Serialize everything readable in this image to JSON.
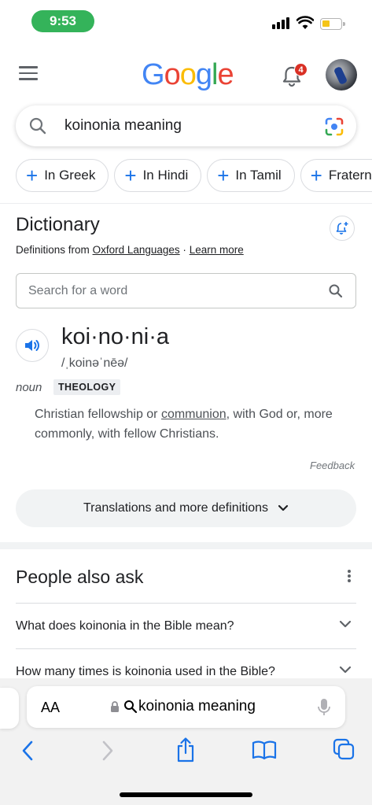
{
  "status_bar": {
    "time": "9:53"
  },
  "header": {
    "notification_count": "4"
  },
  "search": {
    "query": "koinonia meaning"
  },
  "chips": [
    {
      "label": "In Greek"
    },
    {
      "label": "In Hindi"
    },
    {
      "label": "In Tamil"
    },
    {
      "label": "Fraternity"
    }
  ],
  "dictionary": {
    "title": "Dictionary",
    "source_prefix": "Definitions from",
    "source_name": "Oxford Languages",
    "source_sep": "·",
    "learn_more": "Learn more",
    "search_placeholder": "Search for a word",
    "headword": "koi·no·ni·a",
    "phonetic": "/ˌkoinəˈnēə/",
    "part_of_speech": "noun",
    "subject": "THEOLOGY",
    "definition_before": "Christian fellowship or ",
    "definition_link": "communion",
    "definition_after": ", with God or, more commonly, with fellow Christians.",
    "feedback": "Feedback",
    "more_button": "Translations and more definitions"
  },
  "people_also_ask": {
    "title": "People also ask",
    "questions": [
      "What does koinonia in the Bible mean?",
      "How many times is koinonia used in the Bible?"
    ]
  },
  "browser": {
    "text_size": "AA",
    "url": "koinonia meaning"
  },
  "colors": {
    "accent_blue": "#1a73e8",
    "status_pill": "#34b35a",
    "badge_red": "#d93025",
    "battery_yellow": "#f5c518",
    "safari_blue": "#1a73e8"
  }
}
